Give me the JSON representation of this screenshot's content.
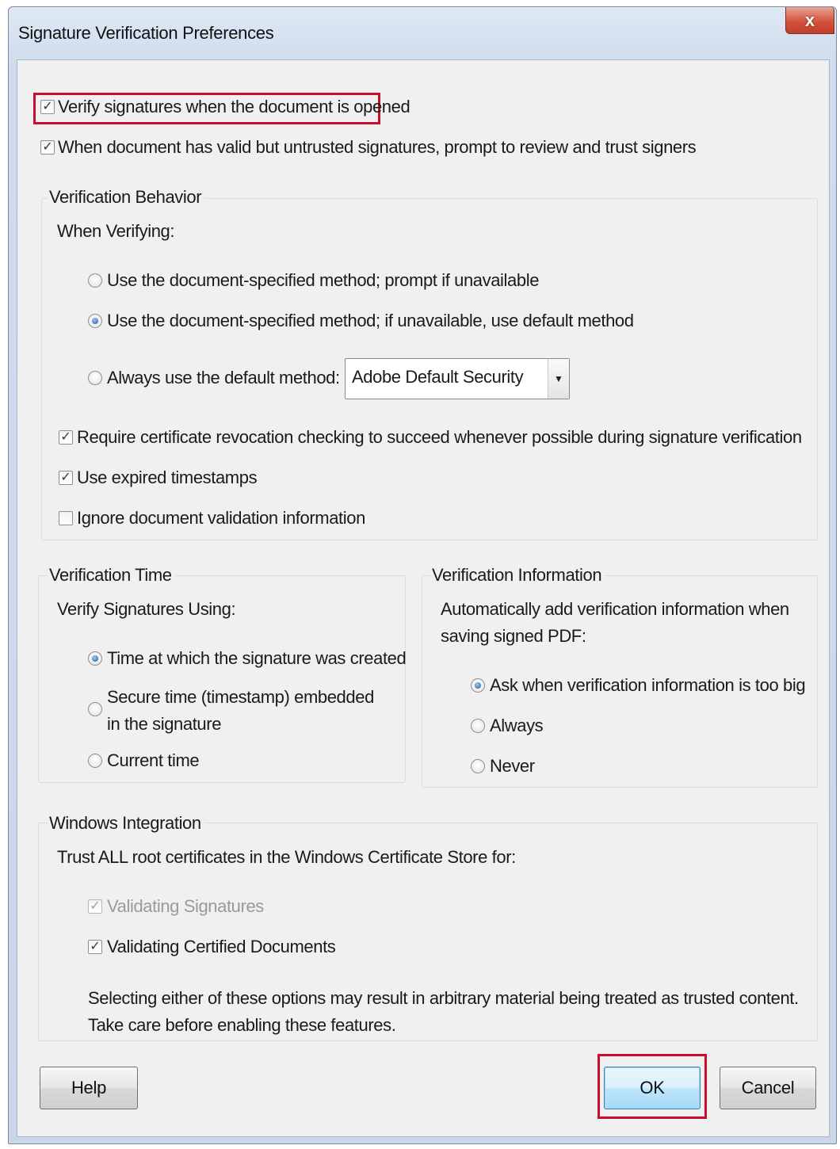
{
  "window": {
    "title": "Signature Verification Preferences",
    "close_label": "x"
  },
  "top_options": {
    "verify_on_open": {
      "label": "Verify signatures when the document is opened",
      "checked": true
    },
    "prompt_untrusted": {
      "label": "When document has valid but untrusted signatures, prompt to review and trust signers",
      "checked": true
    }
  },
  "verification_behavior": {
    "title": "Verification Behavior",
    "when_verifying": "When Verifying:",
    "methods": [
      {
        "label": "Use the document-specified method; prompt if unavailable",
        "selected": false
      },
      {
        "label": "Use the document-specified method; if unavailable, use default method",
        "selected": true
      },
      {
        "label": "Always use the default method:",
        "selected": false
      }
    ],
    "default_method": "Adobe Default Security",
    "require_revocation": {
      "label": "Require certificate revocation checking to succeed whenever possible during signature verification",
      "checked": true
    },
    "use_expired_timestamps": {
      "label": "Use expired timestamps",
      "checked": true
    },
    "ignore_validation_info": {
      "label": "Ignore document validation information",
      "checked": false
    }
  },
  "verification_time": {
    "title": "Verification Time",
    "subtitle": "Verify Signatures Using:",
    "options": [
      {
        "label": "Time at which the signature was created",
        "selected": true
      },
      {
        "label_line1": "Secure time (timestamp) embedded",
        "label_line2": "in the signature",
        "selected": false
      },
      {
        "label": "Current time",
        "selected": false
      }
    ]
  },
  "verification_information": {
    "title": "Verification Information",
    "subtitle_line1": "Automatically add verification information when",
    "subtitle_line2": "saving signed PDF:",
    "options": [
      {
        "label": "Ask when verification information is too big",
        "selected": true
      },
      {
        "label": "Always",
        "selected": false
      },
      {
        "label": "Never",
        "selected": false
      }
    ]
  },
  "windows_integration": {
    "title": "Windows Integration",
    "subtitle": "Trust ALL root certificates in the Windows Certificate Store for:",
    "validating_signatures": {
      "label": "Validating Signatures",
      "checked": true,
      "enabled": false
    },
    "validating_certified": {
      "label": "Validating Certified Documents",
      "checked": true,
      "enabled": true
    },
    "warning_line1": "Selecting either of these options may result in arbitrary material being treated as trusted content.",
    "warning_line2": "Take care before enabling these features."
  },
  "buttons": {
    "help": "Help",
    "ok": "OK",
    "cancel": "Cancel"
  },
  "colors": {
    "highlight": "#c8102e",
    "dialog_background": "#f0f0f0",
    "titlebar": "#cfdcec",
    "close_button": "#d2533e"
  }
}
